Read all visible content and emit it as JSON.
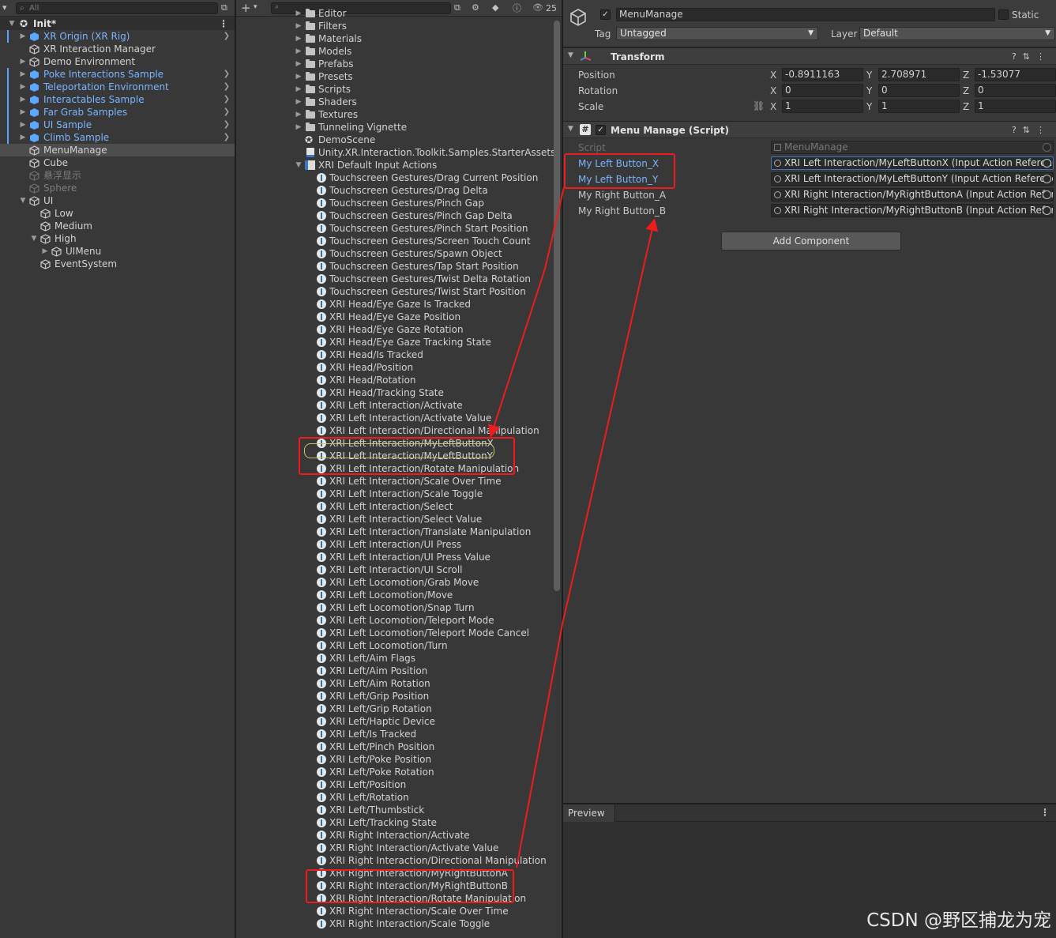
{
  "hierarchy": {
    "search_placeholder": "All",
    "scene": "Init*",
    "items": [
      {
        "label": "XR Origin (XR Rig)",
        "style": "blue",
        "arrow": "▶",
        "chevron": true
      },
      {
        "label": "XR Interaction Manager",
        "style": "normal",
        "arrow": "",
        "chevron": false
      },
      {
        "label": "Demo Environment",
        "style": "normal",
        "arrow": "▶",
        "chevron": false
      },
      {
        "label": "Poke Interactions Sample",
        "style": "blue",
        "arrow": "▶",
        "chevron": true
      },
      {
        "label": "Teleportation Environment",
        "style": "blue",
        "arrow": "▶",
        "chevron": true
      },
      {
        "label": "Interactables Sample",
        "style": "blue",
        "arrow": "▶",
        "chevron": true
      },
      {
        "label": "Far Grab Samples",
        "style": "blue",
        "arrow": "▶",
        "chevron": true
      },
      {
        "label": "UI Sample",
        "style": "blue",
        "arrow": "▶",
        "chevron": true
      },
      {
        "label": "Climb Sample",
        "style": "blue",
        "arrow": "▶",
        "chevron": true
      },
      {
        "label": "MenuManage",
        "style": "selected",
        "arrow": "",
        "chevron": false
      },
      {
        "label": "Cube",
        "style": "normal",
        "arrow": "",
        "chevron": false
      },
      {
        "label": "悬浮显示",
        "style": "grey",
        "arrow": "",
        "chevron": false
      },
      {
        "label": "Sphere",
        "style": "grey",
        "arrow": "",
        "chevron": false
      },
      {
        "label": "UI",
        "style": "normal",
        "arrow": "▼",
        "chevron": false
      },
      {
        "label": "Low",
        "style": "normal",
        "arrow": "",
        "chevron": false
      },
      {
        "label": "Medium",
        "style": "normal",
        "arrow": "",
        "chevron": false
      },
      {
        "label": "High",
        "style": "normal",
        "arrow": "▼",
        "chevron": false
      },
      {
        "label": "UIMenu",
        "style": "normal",
        "arrow": "▶",
        "chevron": false
      },
      {
        "label": "EventSystem",
        "style": "normal",
        "arrow": "",
        "chevron": false
      }
    ]
  },
  "project": {
    "hidden_count": "25",
    "folders": [
      "Editor",
      "Filters",
      "Materials",
      "Models",
      "Prefabs",
      "Presets",
      "Scripts",
      "Shaders",
      "Textures",
      "Tunneling Vignette"
    ],
    "scene_file": "DemoScene",
    "script_file": "Unity.XR.Interaction.Toolkit.Samples.StarterAssets",
    "input_asset": "XRI Default Input Actions",
    "actions": [
      "Touchscreen Gestures/Drag Current Position",
      "Touchscreen Gestures/Drag Delta",
      "Touchscreen Gestures/Pinch Gap",
      "Touchscreen Gestures/Pinch Gap Delta",
      "Touchscreen Gestures/Pinch Start Position",
      "Touchscreen Gestures/Screen Touch Count",
      "Touchscreen Gestures/Spawn Object",
      "Touchscreen Gestures/Tap Start Position",
      "Touchscreen Gestures/Twist Delta Rotation",
      "Touchscreen Gestures/Twist Start Position",
      "XRI Head/Eye Gaze Is Tracked",
      "XRI Head/Eye Gaze Position",
      "XRI Head/Eye Gaze Rotation",
      "XRI Head/Eye Gaze Tracking State",
      "XRI Head/Is Tracked",
      "XRI Head/Position",
      "XRI Head/Rotation",
      "XRI Head/Tracking State",
      "XRI Left Interaction/Activate",
      "XRI Left Interaction/Activate Value",
      "XRI Left Interaction/Directional Manipulation",
      "XRI Left Interaction/MyLeftButtonX",
      "XRI Left Interaction/MyLeftButtonY",
      "XRI Left Interaction/Rotate Manipulation",
      "XRI Left Interaction/Scale Over Time",
      "XRI Left Interaction/Scale Toggle",
      "XRI Left Interaction/Select",
      "XRI Left Interaction/Select Value",
      "XRI Left Interaction/Translate Manipulation",
      "XRI Left Interaction/UI Press",
      "XRI Left Interaction/UI Press Value",
      "XRI Left Interaction/UI Scroll",
      "XRI Left Locomotion/Grab Move",
      "XRI Left Locomotion/Move",
      "XRI Left Locomotion/Snap Turn",
      "XRI Left Locomotion/Teleport Mode",
      "XRI Left Locomotion/Teleport Mode Cancel",
      "XRI Left Locomotion/Turn",
      "XRI Left/Aim Flags",
      "XRI Left/Aim Position",
      "XRI Left/Aim Rotation",
      "XRI Left/Grip Position",
      "XRI Left/Grip Rotation",
      "XRI Left/Haptic Device",
      "XRI Left/Is Tracked",
      "XRI Left/Pinch Position",
      "XRI Left/Poke Position",
      "XRI Left/Poke Rotation",
      "XRI Left/Position",
      "XRI Left/Rotation",
      "XRI Left/Thumbstick",
      "XRI Left/Tracking State",
      "XRI Right Interaction/Activate",
      "XRI Right Interaction/Activate Value",
      "XRI Right Interaction/Directional Manipulation",
      "XRI Right Interaction/MyRightButtonA",
      "XRI Right Interaction/MyRightButtonB",
      "XRI Right Interaction/Rotate Manipulation",
      "XRI Right Interaction/Scale Over Time",
      "XRI Right Interaction/Scale Toggle"
    ]
  },
  "inspector": {
    "object_name": "MenuManage",
    "static_label": "Static",
    "tag_label": "Tag",
    "tag_value": "Untagged",
    "layer_label": "Layer",
    "layer_value": "Default",
    "transform": {
      "title": "Transform",
      "rows": [
        {
          "label": "Position",
          "x": "-0.8911163",
          "y": "2.708971",
          "z": "-1.53077"
        },
        {
          "label": "Rotation",
          "x": "0",
          "y": "0",
          "z": "0"
        },
        {
          "label": "Scale",
          "x": "1",
          "y": "1",
          "z": "1"
        }
      ],
      "axis_x": "X",
      "axis_y": "Y",
      "axis_z": "Z"
    },
    "script_component": {
      "title": "Menu Manage (Script)",
      "script_label": "Script",
      "script_value": "MenuManage",
      "fields": [
        {
          "label": "My Left Button_X",
          "value": "XRI Left Interaction/MyLeftButtonX (Input Action Reference)"
        },
        {
          "label": "My Left Button_Y",
          "value": "XRI Left Interaction/MyLeftButtonY (Input Action Reference)"
        },
        {
          "label": "My Right Button_A",
          "value": "XRI Right Interaction/MyRightButtonA (Input Action Reference)"
        },
        {
          "label": "My Right Button_B",
          "value": "XRI Right Interaction/MyRightButtonB (Input Action Reference)"
        }
      ]
    },
    "add_component": "Add Component",
    "preview_label": "Preview"
  },
  "watermark": "CSDN @野区捕龙为宠",
  "colors": {
    "annotation": "#ee1c1c",
    "highlight": "#c9c260",
    "link_blue": "#7bb4ff"
  }
}
